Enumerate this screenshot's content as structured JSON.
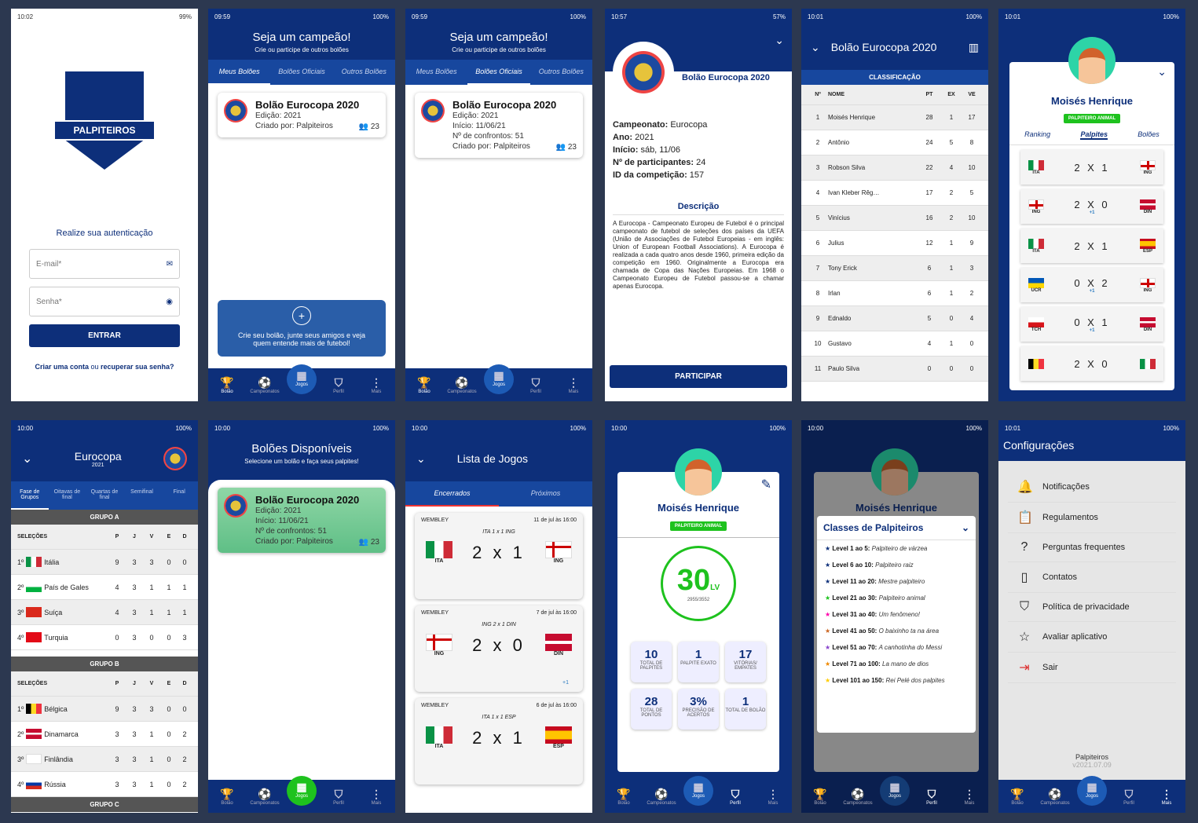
{
  "login": {
    "time": "10:02",
    "batt": "99%",
    "brand": "PALPITEIROS",
    "prompt": "Realize sua autenticação",
    "email_ph": "E-mail*",
    "pass_ph": "Senha*",
    "submit": "ENTRAR",
    "create": "Criar uma conta",
    "or": " ou ",
    "recover": "recuperar sua senha?"
  },
  "status2": {
    "time": "09:59",
    "batt": "100%"
  },
  "champ": {
    "title": "Seja um campeão!",
    "sub": "Crie ou participe de outros bolões",
    "tab1": "Meus Bolões",
    "tab2": "Bolões Oficiais",
    "tab3": "Outros Bolões"
  },
  "card": {
    "title": "Bolão Eurocopa 2020",
    "edition": "Edição: 2021",
    "start": "Início: 11/06/21",
    "matches": "Nº de confrontos: 51",
    "creator": "Criado por: Palpiteiros",
    "count": "23"
  },
  "create_cta": "Crie seu bolão, junte seus amigos e veja quem entende mais de futebol!",
  "nav": {
    "bolao": "Bolão",
    "camp": "Campeonatos",
    "jogos": "Jogos",
    "perfil": "Perfil",
    "mais": "Mais"
  },
  "detail": {
    "time": "10:57",
    "batt": "57%",
    "title": "Bolão Eurocopa 2020",
    "k1": "Campeonato:",
    "v1": " Eurocopa",
    "k2": "Ano:",
    "v2": " 2021",
    "k3": "Início:",
    "v3": " sáb, 11/06",
    "k4": "Nº de participantes:",
    "v4": " 24",
    "k5": "ID da competição:",
    "v5": " 157",
    "desc_title": "Descrição",
    "desc": "A Eurocopa - Campeonato Europeu de Futebol é o principal campeonato de futebol de seleções dos países da UEFA (União de Associações de Futebol Europeias - em inglês: Union of European Football Associations). A Eurocopa é realizada a cada quatro anos desde 1960, primeira edição da competição em 1960. Originalmente a Eurocopa era chamada de Copa das Nações Europeias. Em 1968 o Campeonato Europeu de Futebol passou-se a chamar apenas Eurocopa.",
    "cta": "PARTICIPAR"
  },
  "ranking": {
    "time": "10:01",
    "batt": "100%",
    "title": "Bolão Eurocopa 2020",
    "section": "CLASSIFICAÇÃO",
    "cols": [
      "Nº",
      "NOME",
      "PT",
      "EX",
      "VE"
    ],
    "rows": [
      [
        "1",
        "Moisés Henrique",
        "28",
        "1",
        "17"
      ],
      [
        "2",
        "Antônio",
        "24",
        "5",
        "8"
      ],
      [
        "3",
        "Robson Silva",
        "22",
        "4",
        "10"
      ],
      [
        "4",
        "Ivan Kleber Rêg…",
        "17",
        "2",
        "5"
      ],
      [
        "5",
        "Vinícius",
        "16",
        "2",
        "10"
      ],
      [
        "6",
        "Julius",
        "12",
        "1",
        "9"
      ],
      [
        "7",
        "Tony Erick",
        "6",
        "1",
        "3"
      ],
      [
        "8",
        "Irlan",
        "6",
        "1",
        "2"
      ],
      [
        "9",
        "Ednaldo",
        "5",
        "0",
        "4"
      ],
      [
        "10",
        "Gustavo",
        "4",
        "1",
        "0"
      ],
      [
        "11",
        "Paulo Silva",
        "0",
        "0",
        "0"
      ]
    ]
  },
  "user": {
    "name": "Moisés Henrique",
    "badge": "PALPITEIRO ANIMAL",
    "t1": "Ranking",
    "t2": "Palpites",
    "t3": "Bolões"
  },
  "picks": [
    [
      "ITA",
      "2 X 1",
      "ING",
      ""
    ],
    [
      "ING",
      "2 X 0",
      "DIN",
      "+1"
    ],
    [
      "ITA",
      "2 X 1",
      "ESP",
      ""
    ],
    [
      "UCR",
      "0 X 2",
      "ING",
      "+1"
    ],
    [
      "TCH",
      "0 X 1",
      "DIN",
      "+1"
    ],
    [
      "",
      "2 X 0",
      "",
      " "
    ]
  ],
  "euro": {
    "time": "10:00",
    "batt": "100%",
    "title": "Eurocopa",
    "year": "2021",
    "stages": [
      "Fase de Grupos",
      "Oitavas de final",
      "Quartas de final",
      "Semifinal",
      "Final"
    ],
    "groupA": "GRUPO A",
    "groupB": "GRUPO B",
    "groupC": "GRUPO C",
    "cols": [
      "SELEÇÕES",
      "P",
      "J",
      "V",
      "E",
      "D"
    ],
    "a": [
      [
        "1º",
        "Itália",
        "9",
        "3",
        "3",
        "0",
        "0"
      ],
      [
        "2º",
        "País de Gales",
        "4",
        "3",
        "1",
        "1",
        "1"
      ],
      [
        "3º",
        "Suíça",
        "4",
        "3",
        "1",
        "1",
        "1"
      ],
      [
        "4º",
        "Turquia",
        "0",
        "3",
        "0",
        "0",
        "3"
      ]
    ],
    "b": [
      [
        "1º",
        "Bélgica",
        "9",
        "3",
        "3",
        "0",
        "0"
      ],
      [
        "2º",
        "Dinamarca",
        "3",
        "3",
        "1",
        "0",
        "2"
      ],
      [
        "3º",
        "Finlândia",
        "3",
        "3",
        "1",
        "0",
        "2"
      ],
      [
        "4º",
        "Rússia",
        "3",
        "3",
        "1",
        "0",
        "2"
      ]
    ]
  },
  "avail": {
    "title": "Bolões Disponíveis",
    "sub": "Selecione um bolão e faça seus palpites!"
  },
  "games": {
    "title": "Lista de Jogos",
    "t1": "Encerrados",
    "t2": "Próximos",
    "m": [
      {
        "venue": "WEMBLEY",
        "date": "11 de jul às 16:00",
        "pick": "ITA 1 x 1 ING",
        "h": "ITA",
        "s": "2 x 1",
        "a": "ING",
        "x": ""
      },
      {
        "venue": "WEMBLEY",
        "date": "7 de jul às 16:00",
        "pick": "ING 2 x 1 DIN",
        "h": "ING",
        "s": "2 x 0",
        "a": "DIN",
        "x": "+1"
      },
      {
        "venue": "WEMBLEY",
        "date": "6 de jul às 16:00",
        "pick": "ITA 1 x 1 ESP",
        "h": "ITA",
        "s": "2 x 1",
        "a": "ESP",
        "x": ""
      }
    ]
  },
  "profile": {
    "level": "30",
    "lv": "LV",
    "xp": "2955/3552",
    "stats": [
      [
        "10",
        "TOTAL DE PALPITES"
      ],
      [
        "1",
        "PALPITE EXATO"
      ],
      [
        "17",
        "VITÓRIAS/ EMPATES"
      ],
      [
        "28",
        "TOTAL DE PONTOS"
      ],
      [
        "3%",
        "PRECISÃO DE ACERTOS"
      ],
      [
        "1",
        "TOTAL DE BOLÃO"
      ]
    ]
  },
  "classes": {
    "title": "Classes de Palpiteiros",
    "items": [
      [
        "Level 1 ao 5:",
        "Palpiteiro de várzea"
      ],
      [
        "Level 6 ao 10:",
        "Palpiteiro raiz"
      ],
      [
        "Level 11 ao 20:",
        "Mestre palpiteiro"
      ],
      [
        "Level 21 ao 30:",
        "Palpiteiro animal"
      ],
      [
        "Level 31 ao 40:",
        "Um fenômeno!"
      ],
      [
        "Level 41 ao 50:",
        "O baixinho ta na área"
      ],
      [
        "Level 51 ao 70:",
        "A canhotinha do Messi"
      ],
      [
        "Level 71 ao 100:",
        "La mano de dios"
      ],
      [
        "Level 101 ao 150:",
        "Rei Pelé dos palpites"
      ]
    ]
  },
  "config": {
    "time": "10:01",
    "title": "Configurações",
    "items": [
      "Notificações",
      "Regulamentos",
      "Perguntas frequentes",
      "Contatos",
      "Política de privacidade",
      "Avaliar aplicativo",
      "Sair"
    ],
    "app": "Palpiteiros",
    "ver": "v2021.07.09"
  },
  "colors": {
    "primary": "#0d2f7a",
    "accent": "#1ec21e"
  }
}
